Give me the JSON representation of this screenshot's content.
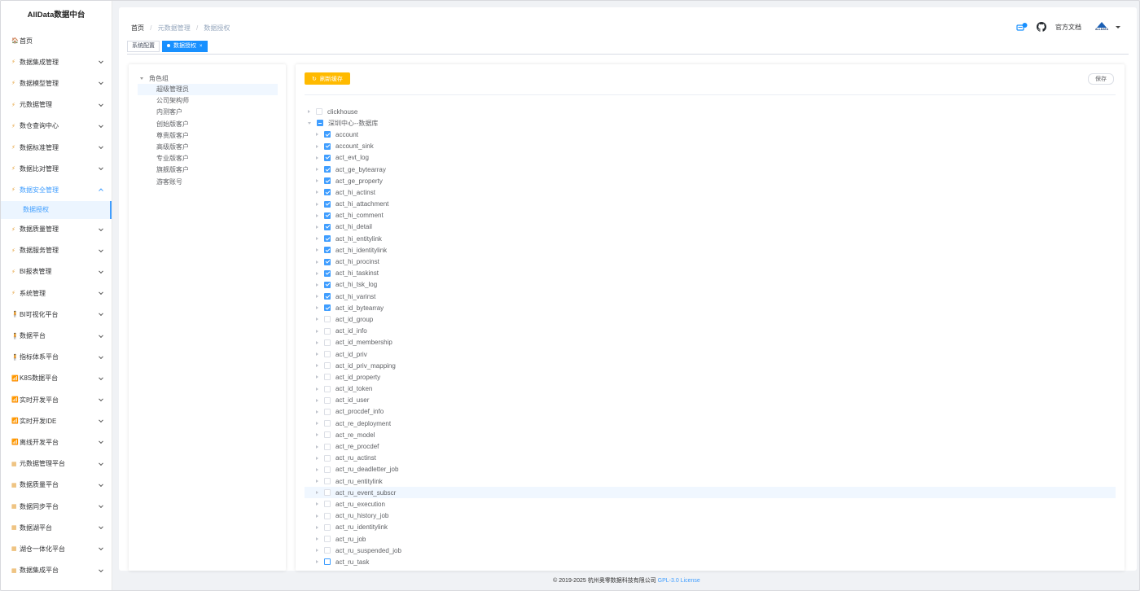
{
  "app": {
    "title": "AllData数据中台"
  },
  "sidebar": {
    "items": [
      {
        "label": "首页",
        "icon": "home-icon",
        "glyph": "🏠",
        "arrow": false
      },
      {
        "label": "数据集成管理",
        "icon": "lightning-icon",
        "glyph": "⚡",
        "arrow": true
      },
      {
        "label": "数据模型管理",
        "icon": "lightning-icon",
        "glyph": "⚡",
        "arrow": true
      },
      {
        "label": "元数据管理",
        "icon": "lightning-icon",
        "glyph": "⚡",
        "arrow": true
      },
      {
        "label": "数仓查询中心",
        "icon": "lightning-icon",
        "glyph": "⚡",
        "arrow": true
      },
      {
        "label": "数据标准管理",
        "icon": "lightning-icon",
        "glyph": "⚡",
        "arrow": true
      },
      {
        "label": "数据比对管理",
        "icon": "lightning-icon",
        "glyph": "⚡",
        "arrow": true
      },
      {
        "label": "数据安全管理",
        "icon": "lightning-icon",
        "glyph": "⚡",
        "arrow": true,
        "open": true
      },
      {
        "label": "数据质量管理",
        "icon": "lightning-icon",
        "glyph": "⚡",
        "arrow": true
      },
      {
        "label": "数据服务管理",
        "icon": "lightning-icon",
        "glyph": "⚡",
        "arrow": true
      },
      {
        "label": "BI报表管理",
        "icon": "lightning-icon",
        "glyph": "⚡",
        "arrow": true
      },
      {
        "label": "系统管理",
        "icon": "lightning-icon",
        "glyph": "⚡",
        "arrow": true
      },
      {
        "label": "BI可视化平台",
        "icon": "person-icon",
        "glyph": "🧍",
        "arrow": true
      },
      {
        "label": "数据平台",
        "icon": "person-icon",
        "glyph": "🧍",
        "arrow": true
      },
      {
        "label": "指标体系平台",
        "icon": "person-icon",
        "glyph": "🧍",
        "arrow": true
      },
      {
        "label": "K8S数据平台",
        "icon": "wifi-icon",
        "glyph": "📶",
        "arrow": true
      },
      {
        "label": "实时开发平台",
        "icon": "wifi-icon",
        "glyph": "📶",
        "arrow": true
      },
      {
        "label": "实时开发IDE",
        "icon": "wifi-icon",
        "glyph": "📶",
        "arrow": true
      },
      {
        "label": "离线开发平台",
        "icon": "wifi-icon",
        "glyph": "📶",
        "arrow": true
      },
      {
        "label": "元数据管理平台",
        "icon": "grid-icon",
        "glyph": "▦",
        "arrow": true
      },
      {
        "label": "数据质量平台",
        "icon": "grid-icon",
        "glyph": "▦",
        "arrow": true
      },
      {
        "label": "数据同步平台",
        "icon": "grid-icon",
        "glyph": "▦",
        "arrow": true
      },
      {
        "label": "数据湖平台",
        "icon": "grid-icon",
        "glyph": "▦",
        "arrow": true
      },
      {
        "label": "湖仓一体化平台",
        "icon": "grid-icon",
        "glyph": "▦",
        "arrow": true
      },
      {
        "label": "数据集成平台",
        "icon": "grid-icon",
        "glyph": "▦",
        "arrow": true
      }
    ],
    "submenu": {
      "parent_index": 7,
      "label": "数据授权"
    }
  },
  "navbar": {
    "breadcrumb": [
      "首页",
      "元数据管理",
      "数据授权"
    ],
    "doc_label": "官方文档",
    "brand_label": "ALLDATA"
  },
  "tags": [
    {
      "label": "系统配置",
      "active": false
    },
    {
      "label": "数据授权",
      "active": true,
      "close": "×"
    }
  ],
  "roles": {
    "root_label": "角色组",
    "items": [
      "超级管理员",
      "公司架构师",
      "内测客户",
      "创始版客户",
      "尊贵版客户",
      "高级版客户",
      "专业版客户",
      "旗舰版客户",
      "游客账号"
    ],
    "selected_index": 0
  },
  "actions": {
    "refresh_label": "刷新缓存",
    "refresh_icon": "↻",
    "save_label": "保存"
  },
  "colors": {
    "primary": "#409eff",
    "warning": "#ffba00",
    "tag_active": "#1890ff"
  },
  "tree": {
    "databases": [
      {
        "label": "clickhouse",
        "expanded": false,
        "state": "unchecked"
      },
      {
        "label": "深圳中心--数据库",
        "expanded": true,
        "state": "indeterminate"
      }
    ],
    "tables": [
      {
        "label": "account",
        "checked": true
      },
      {
        "label": "account_sink",
        "checked": true
      },
      {
        "label": "act_evt_log",
        "checked": true
      },
      {
        "label": "act_ge_bytearray",
        "checked": true
      },
      {
        "label": "act_ge_property",
        "checked": true
      },
      {
        "label": "act_hi_actinst",
        "checked": true
      },
      {
        "label": "act_hi_attachment",
        "checked": true
      },
      {
        "label": "act_hi_comment",
        "checked": true
      },
      {
        "label": "act_hi_detail",
        "checked": true
      },
      {
        "label": "act_hi_entitylink",
        "checked": true
      },
      {
        "label": "act_hi_identitylink",
        "checked": true
      },
      {
        "label": "act_hi_procinst",
        "checked": true
      },
      {
        "label": "act_hi_taskinst",
        "checked": true
      },
      {
        "label": "act_hi_tsk_log",
        "checked": true
      },
      {
        "label": "act_hi_varinst",
        "checked": true
      },
      {
        "label": "act_id_bytearray",
        "checked": true
      },
      {
        "label": "act_id_group",
        "checked": false
      },
      {
        "label": "act_id_info",
        "checked": false
      },
      {
        "label": "act_id_membership",
        "checked": false
      },
      {
        "label": "act_id_priv",
        "checked": false
      },
      {
        "label": "act_id_priv_mapping",
        "checked": false
      },
      {
        "label": "act_id_property",
        "checked": false
      },
      {
        "label": "act_id_token",
        "checked": false
      },
      {
        "label": "act_id_user",
        "checked": false
      },
      {
        "label": "act_procdef_info",
        "checked": false
      },
      {
        "label": "act_re_deployment",
        "checked": false
      },
      {
        "label": "act_re_model",
        "checked": false
      },
      {
        "label": "act_re_procdef",
        "checked": false
      },
      {
        "label": "act_ru_actinst",
        "checked": false
      },
      {
        "label": "act_ru_deadletter_job",
        "checked": false
      },
      {
        "label": "act_ru_entitylink",
        "checked": false
      },
      {
        "label": "act_ru_event_subscr",
        "checked": false,
        "hover": true
      },
      {
        "label": "act_ru_execution",
        "checked": false
      },
      {
        "label": "act_ru_history_job",
        "checked": false
      },
      {
        "label": "act_ru_identitylink",
        "checked": false
      },
      {
        "label": "act_ru_job",
        "checked": false
      },
      {
        "label": "act_ru_suspended_job",
        "checked": false
      },
      {
        "label": "act_ru_task",
        "checked": false,
        "focus": true
      }
    ]
  },
  "footer": {
    "copyright": "© 2019-2025 杭州奥零数据科技有限公司",
    "license": "GPL-3.0 License"
  }
}
